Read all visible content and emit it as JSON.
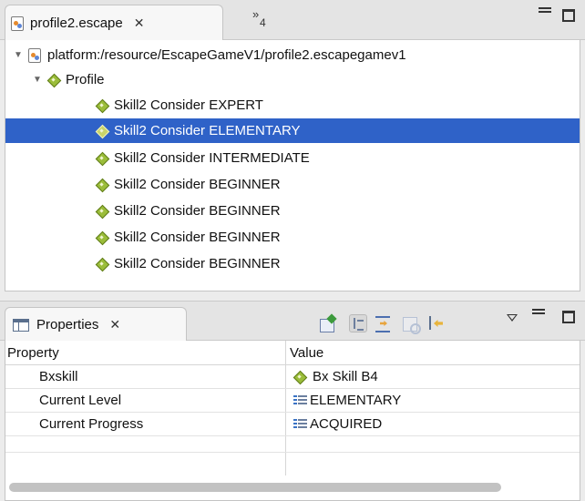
{
  "editor": {
    "tab_label": "profile2.escape",
    "overflow_count": "4",
    "tree": {
      "root_label": "platform:/resource/EscapeGameV1/profile2.escapegamev1",
      "profile_label": "Profile",
      "skills": [
        {
          "label": "Skill2 Consider EXPERT",
          "selected": false
        },
        {
          "label": "Skill2 Consider ELEMENTARY",
          "selected": true
        },
        {
          "label": "Skill2 Consider INTERMEDIATE",
          "selected": false
        },
        {
          "label": "Skill2 Consider BEGINNER",
          "selected": false
        },
        {
          "label": "Skill2 Consider BEGINNER",
          "selected": false
        },
        {
          "label": "Skill2 Consider BEGINNER",
          "selected": false
        },
        {
          "label": "Skill2 Consider BEGINNER",
          "selected": false
        }
      ]
    }
  },
  "properties": {
    "tab_label": "Properties",
    "columns": {
      "property": "Property",
      "value": "Value"
    },
    "rows": [
      {
        "property": "Bxskill",
        "value": "Bx Skill B4",
        "icon": "element-diamond-icon"
      },
      {
        "property": "Current Level",
        "value": "ELEMENTARY",
        "icon": "enum-literal-icon"
      },
      {
        "property": "Current Progress",
        "value": "ACQUIRED",
        "icon": "enum-literal-icon"
      }
    ]
  },
  "colors": {
    "selection": "#2f62c8",
    "background": "#ececec"
  }
}
